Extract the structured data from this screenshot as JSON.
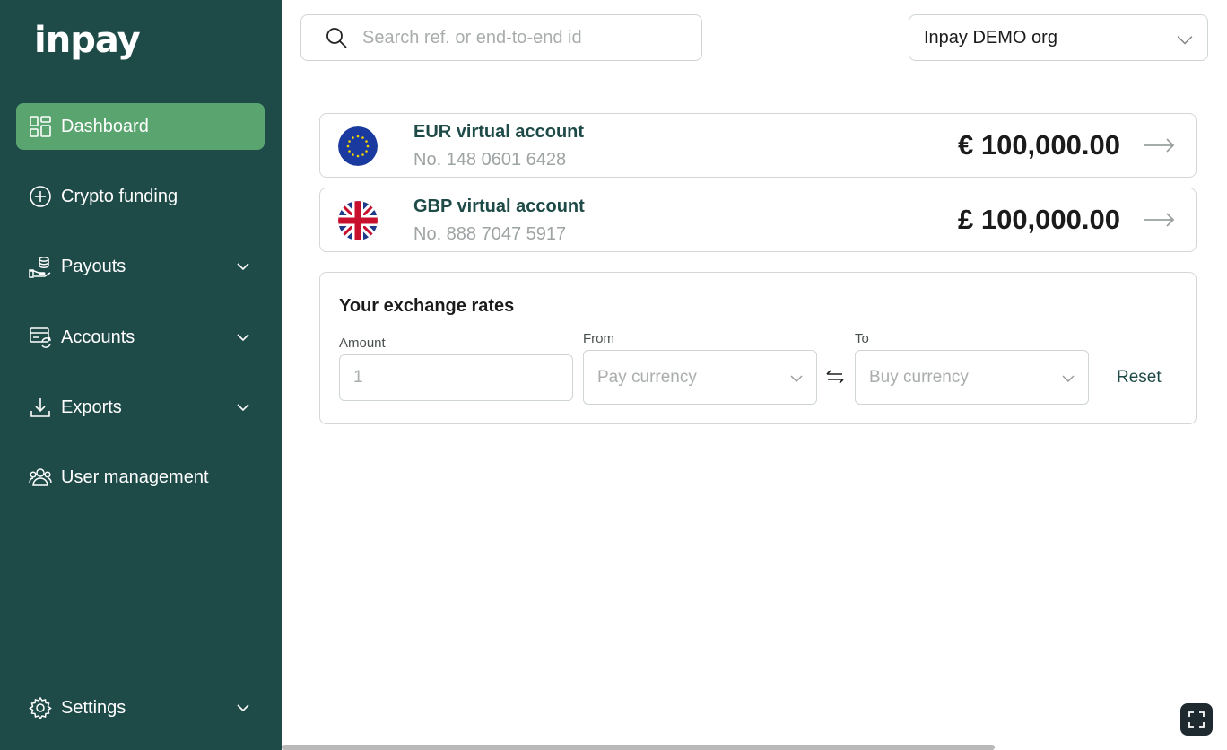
{
  "brand": {
    "logo_text": "inpay"
  },
  "colors": {
    "sidebar_bg": "#1e4a48",
    "active_nav": "#5aa470",
    "accent_text": "#1e4a48"
  },
  "sidebar": {
    "items": [
      {
        "label": "Dashboard",
        "icon": "dashboard-icon",
        "active": true,
        "expandable": false
      },
      {
        "label": "Crypto funding",
        "icon": "plus-circle-icon",
        "active": false,
        "expandable": false
      },
      {
        "label": "Payouts",
        "icon": "payouts-icon",
        "active": false,
        "expandable": true
      },
      {
        "label": "Accounts",
        "icon": "accounts-icon",
        "active": false,
        "expandable": true
      },
      {
        "label": "Exports",
        "icon": "download-icon",
        "active": false,
        "expandable": true
      },
      {
        "label": "User management",
        "icon": "users-icon",
        "active": false,
        "expandable": false
      },
      {
        "label": "Settings",
        "icon": "gear-icon",
        "active": false,
        "expandable": true
      }
    ]
  },
  "search": {
    "placeholder": "Search ref. or end-to-end id",
    "value": ""
  },
  "org_select": {
    "value": "Inpay DEMO org"
  },
  "accounts": [
    {
      "name": "EUR virtual account",
      "number": "No. 148 0601 6428",
      "amount": "€ 100,000.00",
      "flag": "eu-flag-icon"
    },
    {
      "name": "GBP virtual account",
      "number": "No. 888 7047 5917",
      "amount": "£ 100,000.00",
      "flag": "uk-flag-icon"
    }
  ],
  "exchange": {
    "title": "Your exchange rates",
    "amount_label": "Amount",
    "amount_placeholder": "1",
    "from_label": "From",
    "from_placeholder": "Pay currency",
    "to_label": "To",
    "to_placeholder": "Buy currency",
    "reset_label": "Reset"
  }
}
